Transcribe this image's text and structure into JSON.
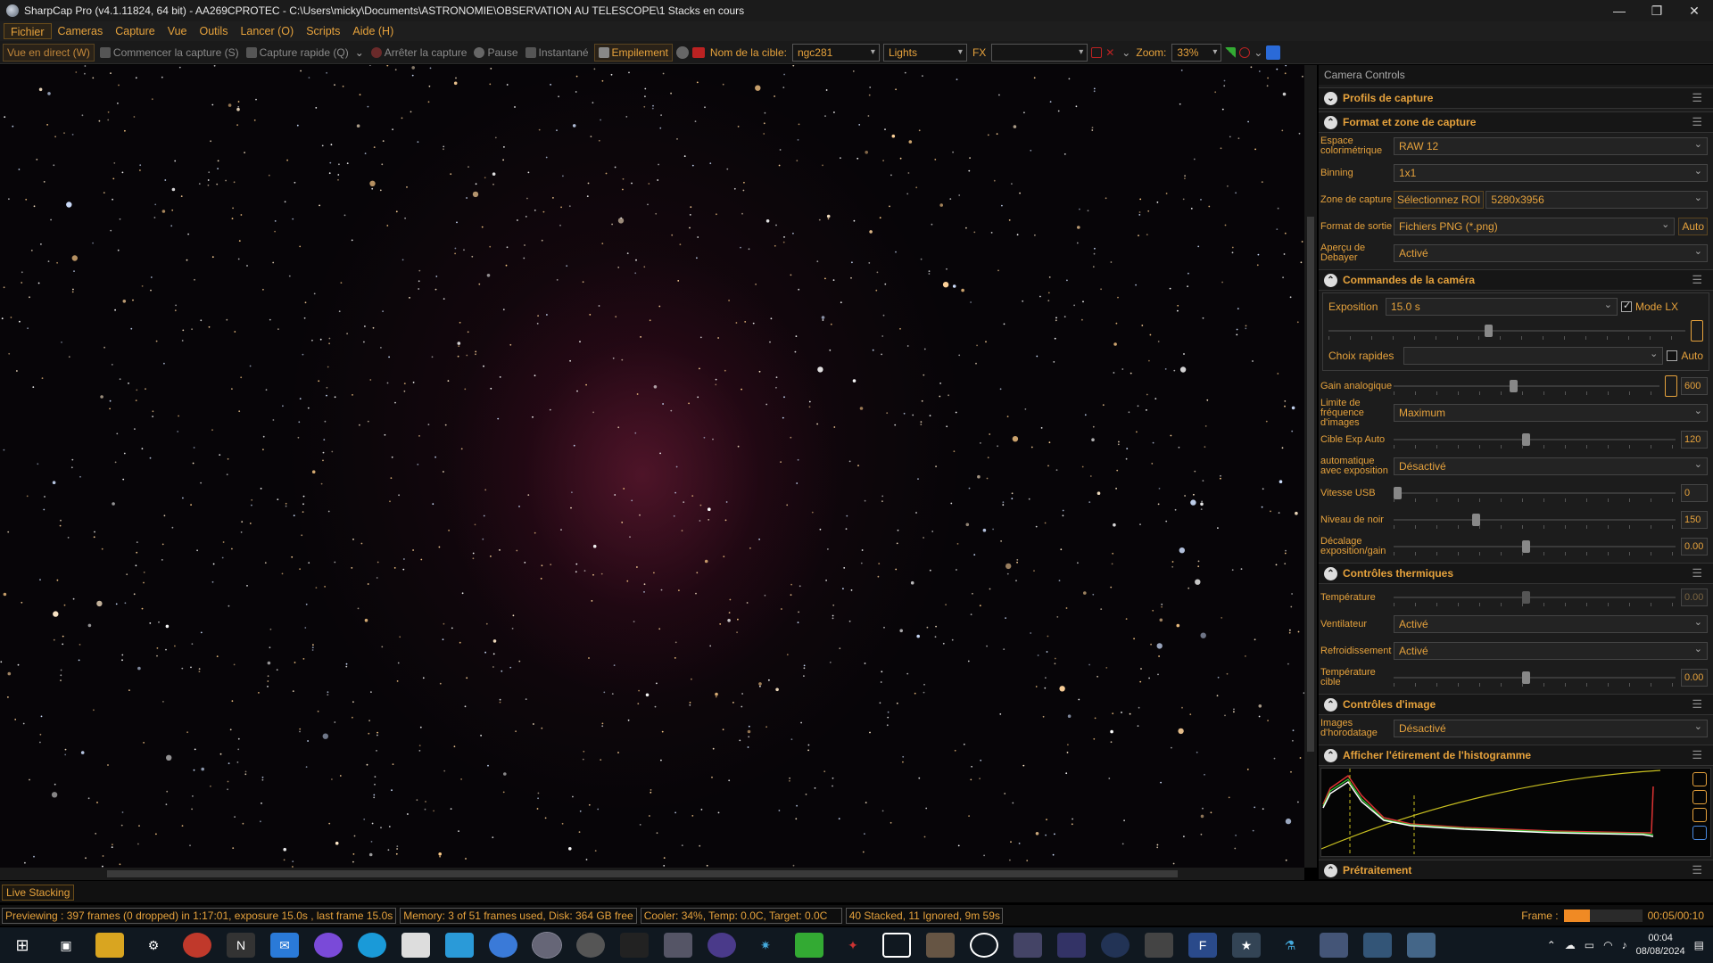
{
  "title": "SharpCap Pro (v4.1.11824, 64 bit) - AA269CPROTEC - C:\\Users\\micky\\Documents\\ASTRONOMIE\\OBSERVATION AU TELESCOPE\\1 Stacks en cours",
  "menu": [
    "Fichier",
    "Cameras",
    "Capture",
    "Vue",
    "Outils",
    "Lancer (O)",
    "Scripts",
    "Aide (H)"
  ],
  "toolbar": {
    "live_view": "Vue en direct (W)",
    "start_capture": "Commencer la capture (S)",
    "quick_capture": "Capture rapide (Q)",
    "stop_capture": "Arrêter la capture",
    "pause": "Pause",
    "snapshot": "Instantané",
    "stacking": "Empilement",
    "target_label": "Nom de la cible:",
    "target_value": "ngc281",
    "frame_type": "Lights",
    "fx_label": "FX",
    "zoom_label": "Zoom:",
    "zoom_value": "33%"
  },
  "panel": {
    "header": "Camera Controls",
    "sections": {
      "profiles": "Profils de capture",
      "format": "Format et zone de capture",
      "camera": "Commandes de la caméra",
      "thermal": "Contrôles thermiques",
      "image": "Contrôles d'image",
      "histogram": "Afficher l'étirement de l'histogramme",
      "preprocessing": "Prétraitement"
    },
    "format": {
      "color_space_label": "Espace colorimétrique",
      "color_space": "RAW 12",
      "binning_label": "Binning",
      "binning": "1x1",
      "capture_area_label": "Zone de capture",
      "roi_button": "Sélectionnez ROI",
      "capture_area": "5280x3956",
      "output_label": "Format de sortie",
      "output": "Fichiers PNG (*.png)",
      "auto_button": "Auto",
      "debayer_label": "Aperçu de Debayer",
      "debayer": "Activé"
    },
    "camera": {
      "exposure_label": "Exposition",
      "exposure": "15.0 s",
      "lx_mode": "Mode LX",
      "quick_choice_label": "Choix rapides",
      "auto": "Auto",
      "gain_label": "Gain analogique",
      "gain": "600",
      "fps_limit_label": "Limite de fréquence d'images",
      "fps_limit": "Maximum",
      "auto_exp_target_label": "Cible Exp Auto",
      "auto_exp_target": "120",
      "auto_exposure_label": "automatique avec exposition",
      "auto_exposure": "Désactivé",
      "usb_label": "Vitesse USB",
      "usb": "0",
      "black_label": "Niveau de noir",
      "black": "150",
      "offset_label": "Décalage exposition/gain",
      "offset": "0.00"
    },
    "thermal": {
      "temp_label": "Température",
      "temp": "0.00",
      "fan_label": "Ventilateur",
      "fan": "Activé",
      "cooling_label": "Refroidissement",
      "cooling": "Activé",
      "target_temp_label": "Température cible",
      "target_temp": "0.00"
    },
    "image": {
      "timestamp_label": "Images d'horodatage",
      "timestamp": "Désactivé"
    }
  },
  "live_stacking_tab": "Live Stacking",
  "status": {
    "preview": "Previewing : 397 frames (0 dropped) in 1:17:01, exposure 15.0s , last frame 15.0s",
    "memory": "Memory: 3 of 51 frames used, Disk: 364 GB free",
    "cooler": "Cooler: 34%, Temp: 0.0C, Target: 0.0C",
    "stacked": "40 Stacked, 11 Ignored, 9m 59s",
    "frame_label": "Frame :",
    "frame_progress": 0.33,
    "frame_time": "00:05/00:10"
  },
  "taskbar": {
    "time": "00:04",
    "date": "08/08/2024"
  },
  "colors": {
    "accent": "#e6a23c",
    "nebula": "#7a1f45"
  }
}
